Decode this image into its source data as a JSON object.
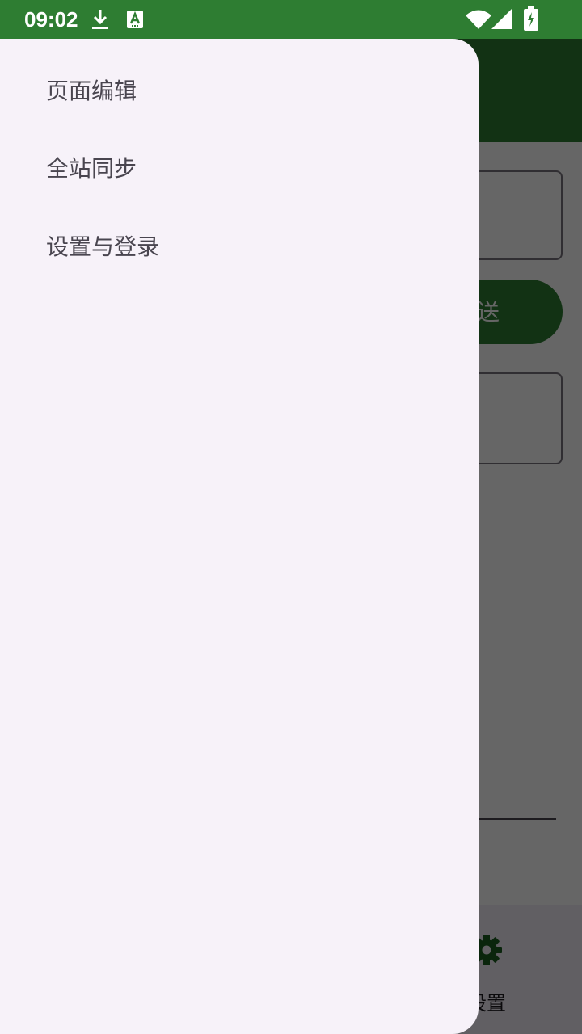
{
  "status_bar": {
    "time": "09:02",
    "icons": [
      "download-icon",
      "keyboard-a-icon",
      "wifi-icon",
      "signal-icon",
      "battery-charging-icon"
    ]
  },
  "drawer": {
    "items": [
      {
        "label": "页面编辑"
      },
      {
        "label": "全站同步"
      },
      {
        "label": "设置与登录"
      }
    ]
  },
  "background_app": {
    "send_button_label": "送",
    "bottom_nav": {
      "settings_label": "设置",
      "settings_icon": "gear-icon"
    }
  },
  "colors": {
    "primary": "#2e7d32",
    "drawer_bg": "#f7f2f9",
    "drawer_text": "#49454f",
    "scrim": "rgba(0,0,0,0.6)"
  }
}
